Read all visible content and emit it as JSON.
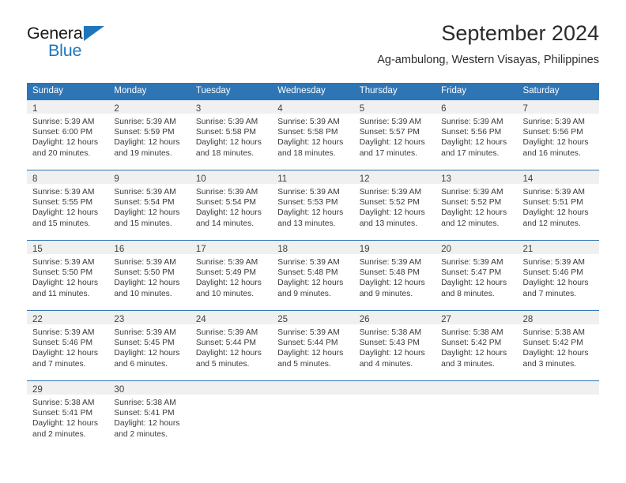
{
  "logo": {
    "line1": "General",
    "line2": "Blue",
    "flag_icon": "triangle-flag-icon",
    "color_text": "#1a1a1a",
    "color_accent": "#1d76bc"
  },
  "header": {
    "title": "September 2024",
    "subtitle": "Ag-ambulong, Western Visayas, Philippines"
  },
  "theme": {
    "header_blue": "#2e75b6",
    "band_gray": "#f0f0f0",
    "text_dark": "#3a3a3a"
  },
  "calendar": {
    "weekday_headers": [
      "Sunday",
      "Monday",
      "Tuesday",
      "Wednesday",
      "Thursday",
      "Friday",
      "Saturday"
    ],
    "weeks": [
      [
        {
          "day": "1",
          "sunrise": "Sunrise: 5:39 AM",
          "sunset": "Sunset: 6:00 PM",
          "daylight": "Daylight: 12 hours and 20 minutes."
        },
        {
          "day": "2",
          "sunrise": "Sunrise: 5:39 AM",
          "sunset": "Sunset: 5:59 PM",
          "daylight": "Daylight: 12 hours and 19 minutes."
        },
        {
          "day": "3",
          "sunrise": "Sunrise: 5:39 AM",
          "sunset": "Sunset: 5:58 PM",
          "daylight": "Daylight: 12 hours and 18 minutes."
        },
        {
          "day": "4",
          "sunrise": "Sunrise: 5:39 AM",
          "sunset": "Sunset: 5:58 PM",
          "daylight": "Daylight: 12 hours and 18 minutes."
        },
        {
          "day": "5",
          "sunrise": "Sunrise: 5:39 AM",
          "sunset": "Sunset: 5:57 PM",
          "daylight": "Daylight: 12 hours and 17 minutes."
        },
        {
          "day": "6",
          "sunrise": "Sunrise: 5:39 AM",
          "sunset": "Sunset: 5:56 PM",
          "daylight": "Daylight: 12 hours and 17 minutes."
        },
        {
          "day": "7",
          "sunrise": "Sunrise: 5:39 AM",
          "sunset": "Sunset: 5:56 PM",
          "daylight": "Daylight: 12 hours and 16 minutes."
        }
      ],
      [
        {
          "day": "8",
          "sunrise": "Sunrise: 5:39 AM",
          "sunset": "Sunset: 5:55 PM",
          "daylight": "Daylight: 12 hours and 15 minutes."
        },
        {
          "day": "9",
          "sunrise": "Sunrise: 5:39 AM",
          "sunset": "Sunset: 5:54 PM",
          "daylight": "Daylight: 12 hours and 15 minutes."
        },
        {
          "day": "10",
          "sunrise": "Sunrise: 5:39 AM",
          "sunset": "Sunset: 5:54 PM",
          "daylight": "Daylight: 12 hours and 14 minutes."
        },
        {
          "day": "11",
          "sunrise": "Sunrise: 5:39 AM",
          "sunset": "Sunset: 5:53 PM",
          "daylight": "Daylight: 12 hours and 13 minutes."
        },
        {
          "day": "12",
          "sunrise": "Sunrise: 5:39 AM",
          "sunset": "Sunset: 5:52 PM",
          "daylight": "Daylight: 12 hours and 13 minutes."
        },
        {
          "day": "13",
          "sunrise": "Sunrise: 5:39 AM",
          "sunset": "Sunset: 5:52 PM",
          "daylight": "Daylight: 12 hours and 12 minutes."
        },
        {
          "day": "14",
          "sunrise": "Sunrise: 5:39 AM",
          "sunset": "Sunset: 5:51 PM",
          "daylight": "Daylight: 12 hours and 12 minutes."
        }
      ],
      [
        {
          "day": "15",
          "sunrise": "Sunrise: 5:39 AM",
          "sunset": "Sunset: 5:50 PM",
          "daylight": "Daylight: 12 hours and 11 minutes."
        },
        {
          "day": "16",
          "sunrise": "Sunrise: 5:39 AM",
          "sunset": "Sunset: 5:50 PM",
          "daylight": "Daylight: 12 hours and 10 minutes."
        },
        {
          "day": "17",
          "sunrise": "Sunrise: 5:39 AM",
          "sunset": "Sunset: 5:49 PM",
          "daylight": "Daylight: 12 hours and 10 minutes."
        },
        {
          "day": "18",
          "sunrise": "Sunrise: 5:39 AM",
          "sunset": "Sunset: 5:48 PM",
          "daylight": "Daylight: 12 hours and 9 minutes."
        },
        {
          "day": "19",
          "sunrise": "Sunrise: 5:39 AM",
          "sunset": "Sunset: 5:48 PM",
          "daylight": "Daylight: 12 hours and 9 minutes."
        },
        {
          "day": "20",
          "sunrise": "Sunrise: 5:39 AM",
          "sunset": "Sunset: 5:47 PM",
          "daylight": "Daylight: 12 hours and 8 minutes."
        },
        {
          "day": "21",
          "sunrise": "Sunrise: 5:39 AM",
          "sunset": "Sunset: 5:46 PM",
          "daylight": "Daylight: 12 hours and 7 minutes."
        }
      ],
      [
        {
          "day": "22",
          "sunrise": "Sunrise: 5:39 AM",
          "sunset": "Sunset: 5:46 PM",
          "daylight": "Daylight: 12 hours and 7 minutes."
        },
        {
          "day": "23",
          "sunrise": "Sunrise: 5:39 AM",
          "sunset": "Sunset: 5:45 PM",
          "daylight": "Daylight: 12 hours and 6 minutes."
        },
        {
          "day": "24",
          "sunrise": "Sunrise: 5:39 AM",
          "sunset": "Sunset: 5:44 PM",
          "daylight": "Daylight: 12 hours and 5 minutes."
        },
        {
          "day": "25",
          "sunrise": "Sunrise: 5:39 AM",
          "sunset": "Sunset: 5:44 PM",
          "daylight": "Daylight: 12 hours and 5 minutes."
        },
        {
          "day": "26",
          "sunrise": "Sunrise: 5:38 AM",
          "sunset": "Sunset: 5:43 PM",
          "daylight": "Daylight: 12 hours and 4 minutes."
        },
        {
          "day": "27",
          "sunrise": "Sunrise: 5:38 AM",
          "sunset": "Sunset: 5:42 PM",
          "daylight": "Daylight: 12 hours and 3 minutes."
        },
        {
          "day": "28",
          "sunrise": "Sunrise: 5:38 AM",
          "sunset": "Sunset: 5:42 PM",
          "daylight": "Daylight: 12 hours and 3 minutes."
        }
      ],
      [
        {
          "day": "29",
          "sunrise": "Sunrise: 5:38 AM",
          "sunset": "Sunset: 5:41 PM",
          "daylight": "Daylight: 12 hours and 2 minutes."
        },
        {
          "day": "30",
          "sunrise": "Sunrise: 5:38 AM",
          "sunset": "Sunset: 5:41 PM",
          "daylight": "Daylight: 12 hours and 2 minutes."
        },
        {
          "day": "",
          "sunrise": "",
          "sunset": "",
          "daylight": ""
        },
        {
          "day": "",
          "sunrise": "",
          "sunset": "",
          "daylight": ""
        },
        {
          "day": "",
          "sunrise": "",
          "sunset": "",
          "daylight": ""
        },
        {
          "day": "",
          "sunrise": "",
          "sunset": "",
          "daylight": ""
        },
        {
          "day": "",
          "sunrise": "",
          "sunset": "",
          "daylight": ""
        }
      ]
    ]
  }
}
